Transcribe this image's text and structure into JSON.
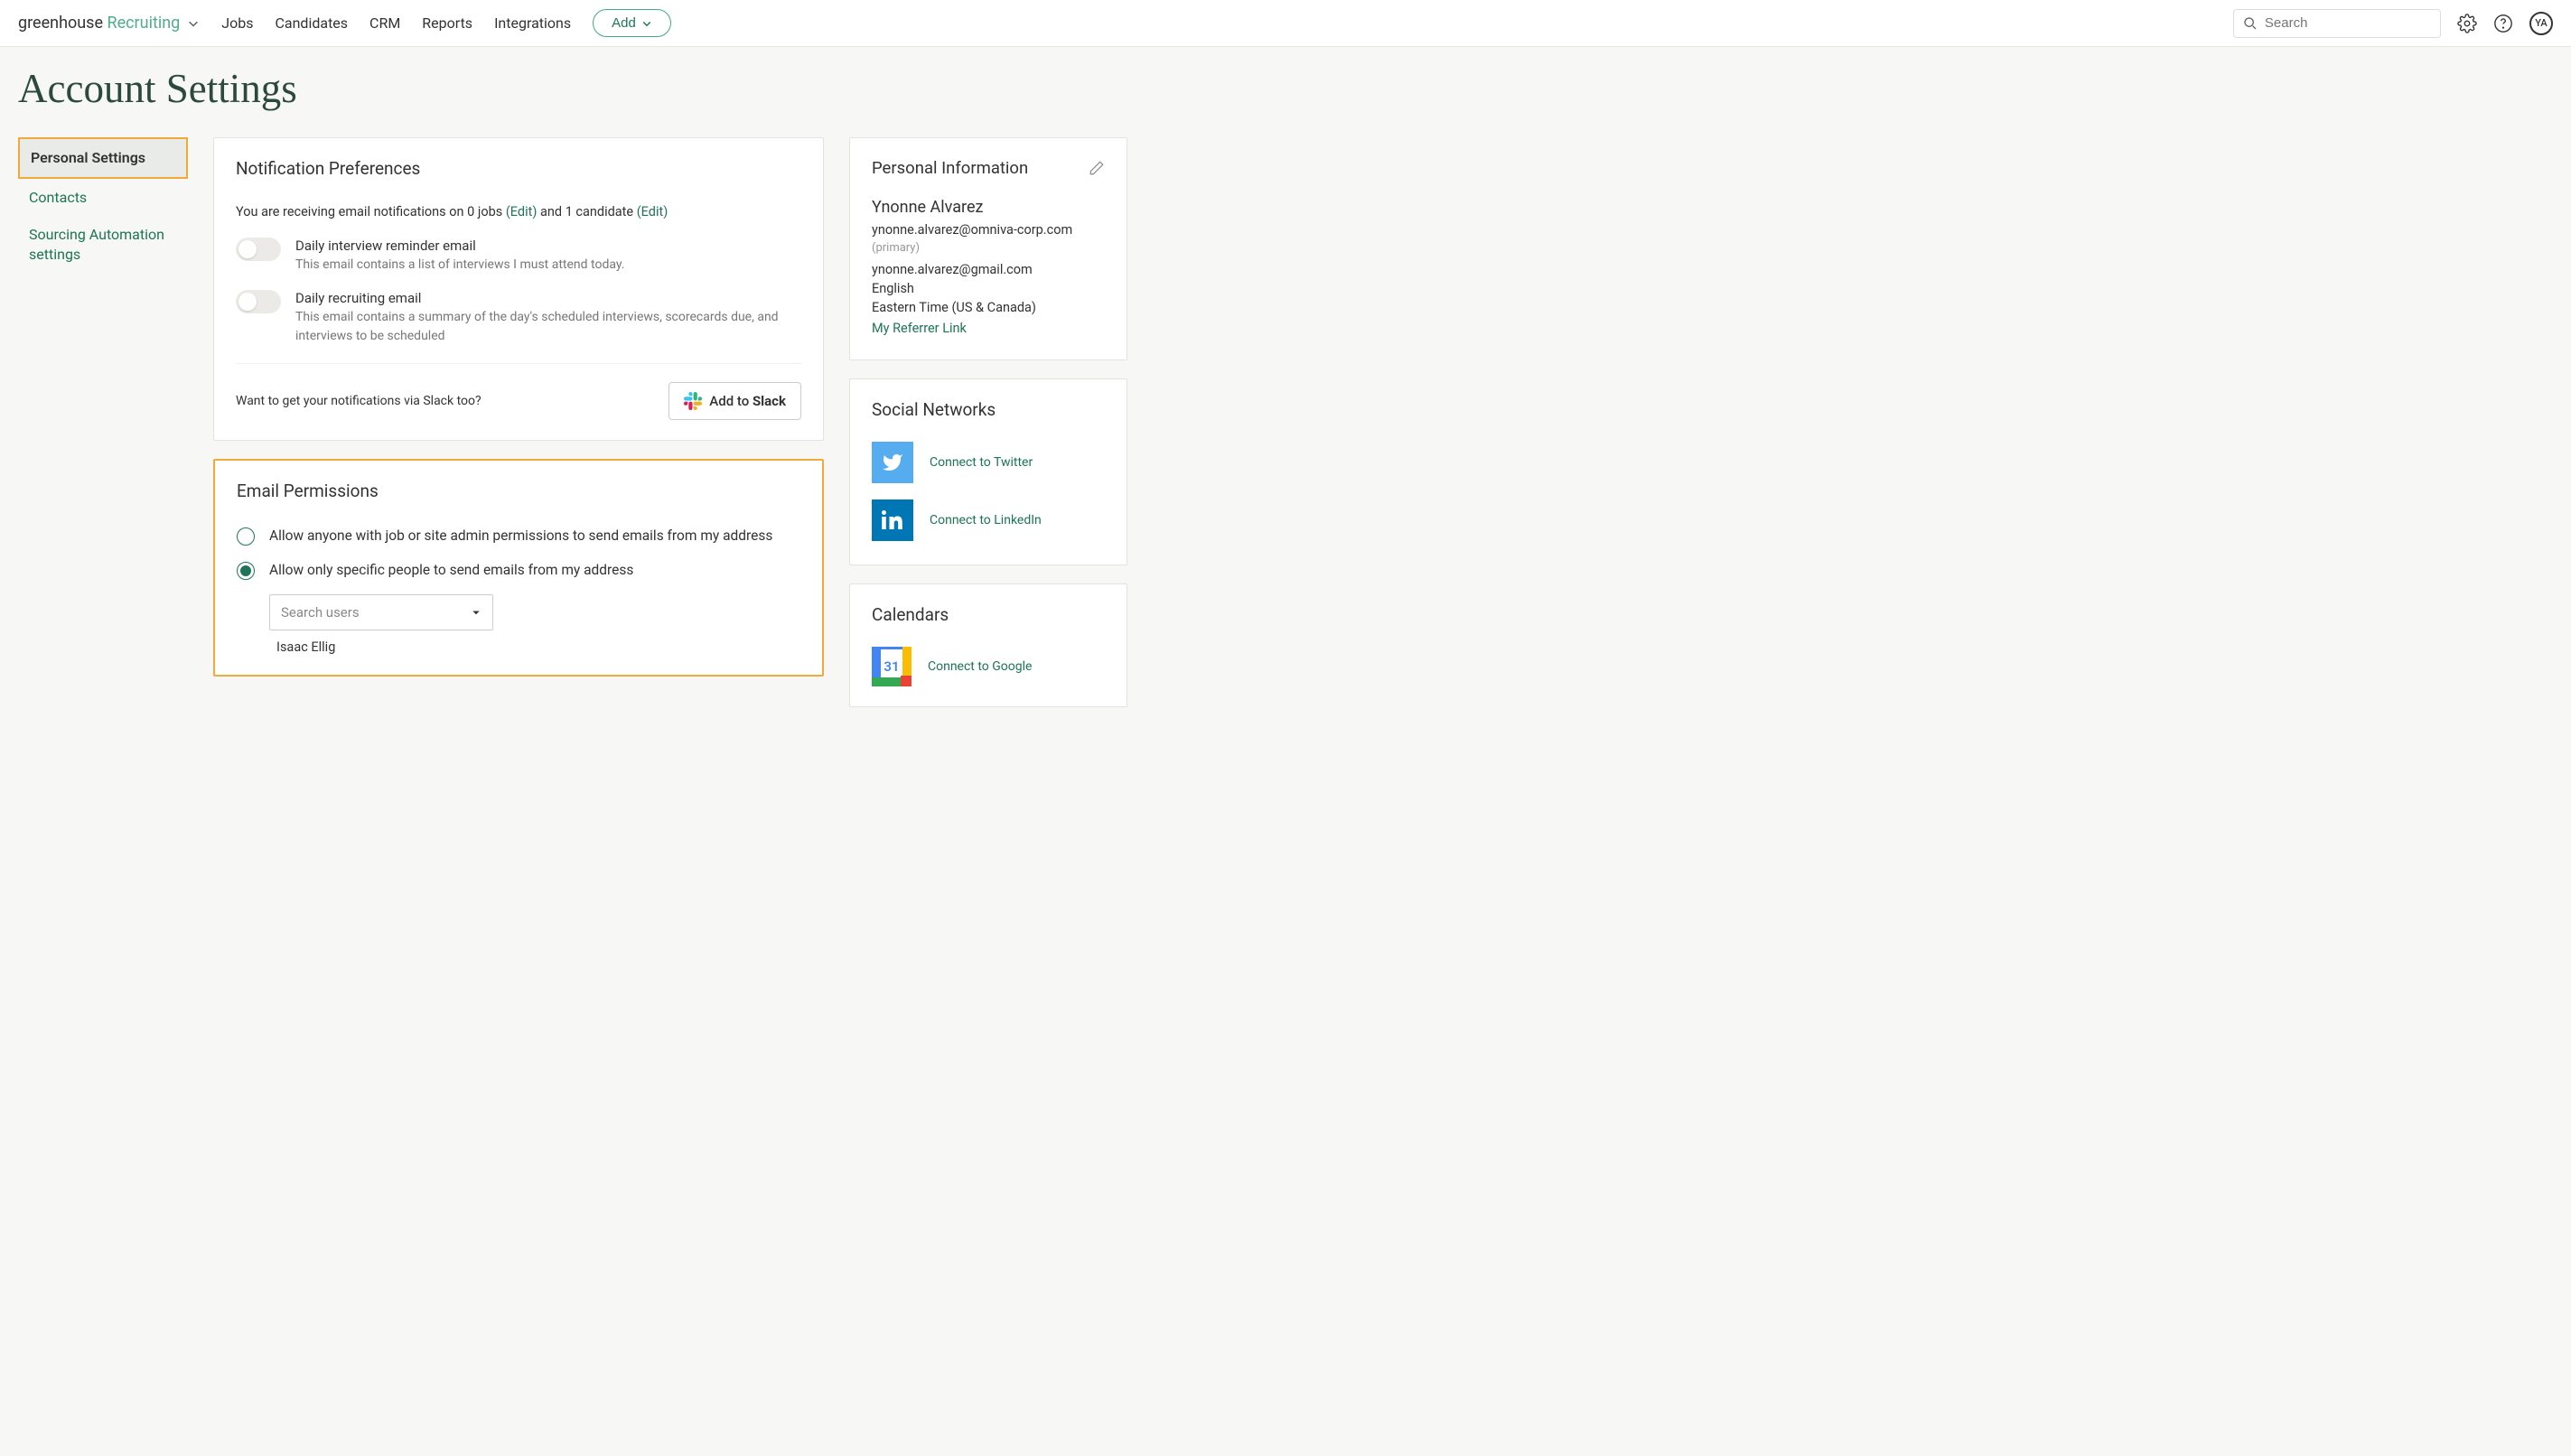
{
  "topnav": {
    "logo_left": "greenhouse",
    "logo_right": "Recruiting",
    "links": [
      "Jobs",
      "Candidates",
      "CRM",
      "Reports",
      "Integrations"
    ],
    "add_label": "Add",
    "search_placeholder": "Search",
    "avatar_initials": "YA"
  },
  "page_title": "Account Settings",
  "sidebar": {
    "items": [
      {
        "label": "Personal Settings",
        "active": true
      },
      {
        "label": "Contacts",
        "active": false
      },
      {
        "label": "Sourcing Automation settings",
        "active": false
      }
    ]
  },
  "notif": {
    "title": "Notification Preferences",
    "line_prefix": "You are receiving email notifications on 0 jobs ",
    "edit1": "(Edit)",
    "line_mid": " and 1 candidate ",
    "edit2": "(Edit)",
    "toggles": [
      {
        "title": "Daily interview reminder email",
        "desc": "This email contains a list of interviews I must attend today.",
        "on": false
      },
      {
        "title": "Daily recruiting email",
        "desc": "This email contains a summary of the day's scheduled interviews, scorecards due, and interviews to be scheduled",
        "on": false
      }
    ],
    "slack_prompt": "Want to get your notifications via Slack too?",
    "slack_btn_prefix": "Add to ",
    "slack_btn_strong": "Slack"
  },
  "email_perm": {
    "title": "Email Permissions",
    "options": [
      {
        "label": "Allow anyone with job or site admin permissions to send emails from my address",
        "selected": false
      },
      {
        "label": "Allow only specific people to send emails from my address",
        "selected": true
      }
    ],
    "select_placeholder": "Search users",
    "selected_users": [
      "Isaac Ellig"
    ]
  },
  "personal": {
    "title": "Personal Information",
    "name": "Ynonne Alvarez",
    "email1": "ynonne.alvarez@omniva-corp.com",
    "primary_tag": "(primary)",
    "email2": "ynonne.alvarez@gmail.com",
    "language": "English",
    "timezone": "Eastern Time (US & Canada)",
    "referrer": "My Referrer Link"
  },
  "social": {
    "title": "Social Networks",
    "twitter": "Connect to Twitter",
    "linkedin": "Connect to LinkedIn"
  },
  "calendars": {
    "title": "Calendars",
    "day_number": "31",
    "google": "Connect to Google"
  }
}
